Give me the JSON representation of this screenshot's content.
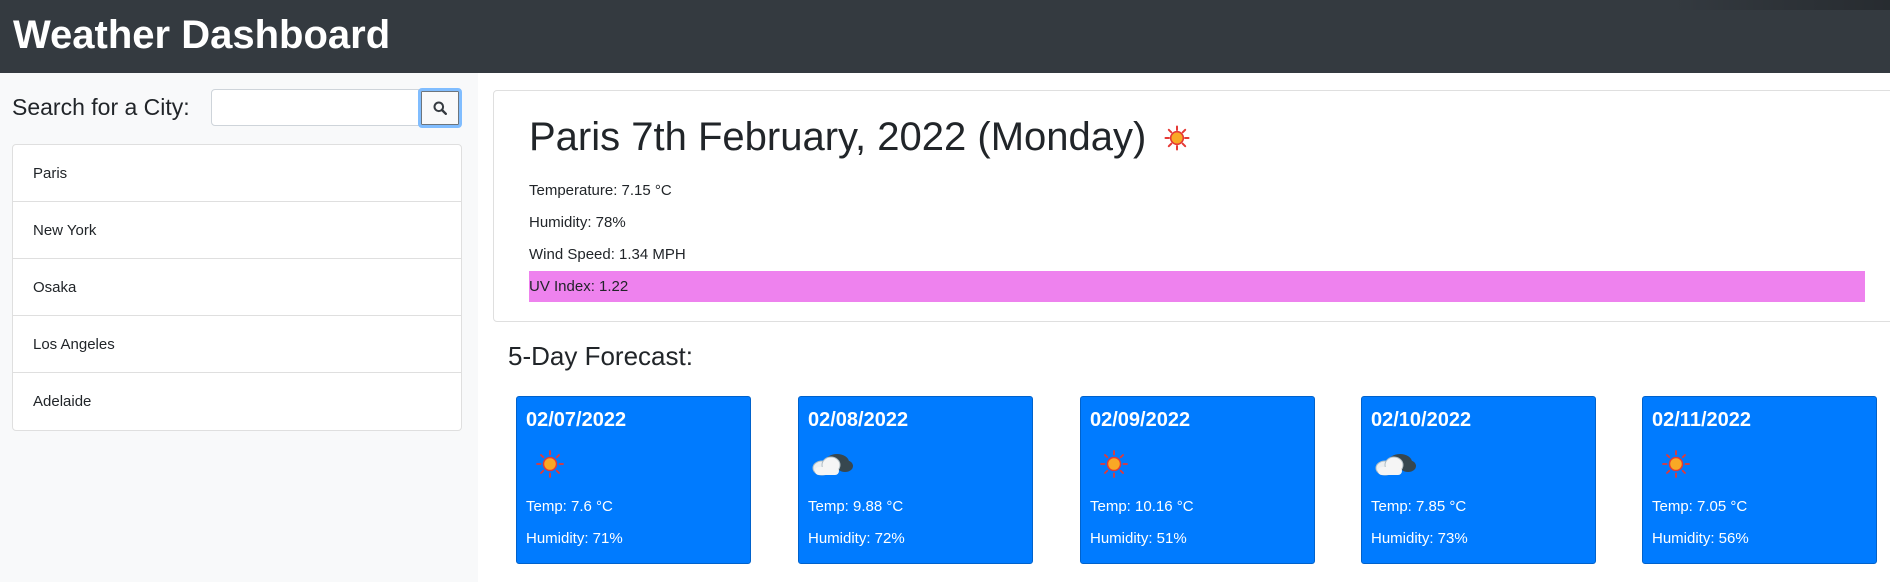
{
  "header": {
    "title": "Weather Dashboard"
  },
  "sidebar": {
    "search_label": "Search for a City:",
    "search_value": "",
    "search_placeholder": "",
    "search_button_icon": "search-icon",
    "cities": [
      "Paris",
      "New York",
      "Osaka",
      "Los Angeles",
      "Adelaide"
    ]
  },
  "current": {
    "title": "Paris 7th February, 2022 (Monday)",
    "icon": "sun-icon",
    "temperature": "Temperature: 7.15 °C",
    "humidity": "Humidity: 78%",
    "wind": "Wind Speed: 1.34 MPH",
    "uv": "UV Index: 1.22",
    "uv_color": "#ee82ee"
  },
  "forecast": {
    "title": "5-Day Forecast:",
    "card_color": "#007bff",
    "days": [
      {
        "date": "02/07/2022",
        "icon": "sun-icon",
        "temp": "Temp: 7.6 °C",
        "humidity": "Humidity: 71%"
      },
      {
        "date": "02/08/2022",
        "icon": "cloud-icon",
        "temp": "Temp: 9.88 °C",
        "humidity": "Humidity: 72%"
      },
      {
        "date": "02/09/2022",
        "icon": "sun-icon",
        "temp": "Temp: 10.16 °C",
        "humidity": "Humidity: 51%"
      },
      {
        "date": "02/10/2022",
        "icon": "cloud-icon",
        "temp": "Temp: 7.85 °C",
        "humidity": "Humidity: 73%"
      },
      {
        "date": "02/11/2022",
        "icon": "sun-icon",
        "temp": "Temp: 7.05 °C",
        "humidity": "Humidity: 56%"
      }
    ]
  }
}
